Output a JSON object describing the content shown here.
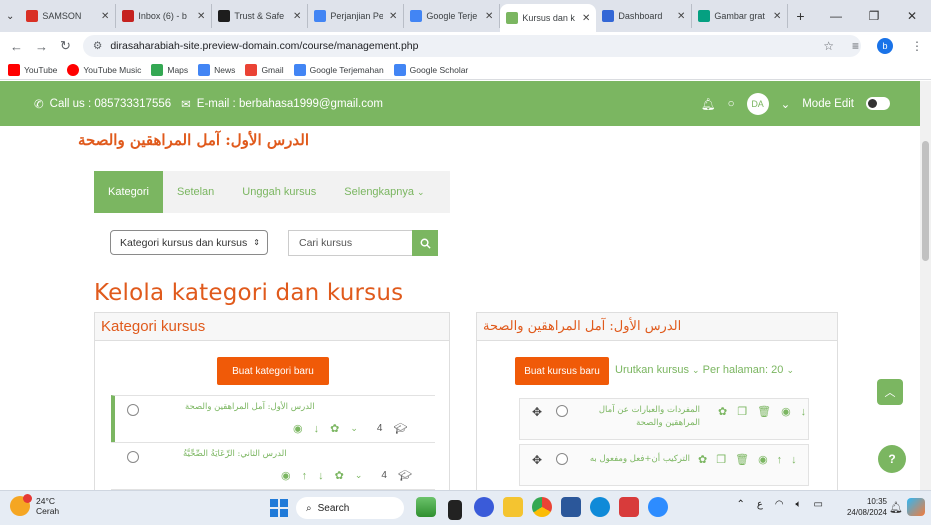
{
  "browser": {
    "tabs": [
      {
        "label": "SAMSON",
        "color": "#d93025",
        "active": false
      },
      {
        "label": "Inbox (6) - b",
        "color": "#c5221f",
        "active": false
      },
      {
        "label": "Trust & Safe",
        "color": "#1d1d1d",
        "active": false
      },
      {
        "label": "Perjanjian Pe",
        "color": "#4285f4",
        "active": false
      },
      {
        "label": "Google Terje",
        "color": "#4285f4",
        "active": false
      },
      {
        "label": "Kursus dan k",
        "color": "#7bb661",
        "active": true
      },
      {
        "label": "Dashboard",
        "color": "#3367d6",
        "active": false
      },
      {
        "label": "Gambar grat",
        "color": "#05a081",
        "active": false
      }
    ],
    "new_tab": "+",
    "url": "dirasaharabiah-site.preview-domain.com/course/management.php",
    "bookmarks": [
      "YouTube",
      "YouTube Music",
      "Maps",
      "News",
      "Gmail",
      "Google Terjemahan",
      "Google Scholar"
    ],
    "profile_initial": "b"
  },
  "topbar": {
    "phone": "Call us : 085733317556",
    "email": "E-mail : berbahasa1999@gmail.com",
    "avatar": "DA",
    "mode_edit": "Mode Edit"
  },
  "course_title": "الدرس الأول: آمل المراهقين والصحة",
  "nav_tabs": [
    "Kategori",
    "Setelan",
    "Unggah kursus",
    "Selengkapnya"
  ],
  "filter_select": "Kategori kursus dan kursus",
  "search_placeholder": "Cari kursus",
  "page_heading": "Kelola kategori dan kursus",
  "left_panel": {
    "title": "Kategori kursus",
    "create_button": "Buat kategori baru",
    "categories": [
      {
        "name": "الدرس الأول: آمل المراهقين والصحة",
        "count": "4"
      },
      {
        "name": "الدرس الثاني: الرِّعَايَةُ الصِّحِّيَّةُ",
        "count": "4"
      }
    ]
  },
  "right_panel": {
    "title": "الدرس الأول: آمل المراهقين والصحة",
    "create_button": "Buat kursus baru",
    "sort_label": "Urutkan kursus",
    "per_page_label": "Per halaman: 20",
    "courses": [
      {
        "name_line1": "المفردات والعبارات عن آمال",
        "name_line2": "المراهقين والصحة"
      },
      {
        "name_line1": "التركيب أن+فعل ومفعول به",
        "name_line2": ""
      }
    ]
  },
  "taskbar": {
    "temperature": "24°C",
    "weather": "Cerah",
    "search": "Search",
    "time": "10:35",
    "date": "24/08/2024"
  }
}
